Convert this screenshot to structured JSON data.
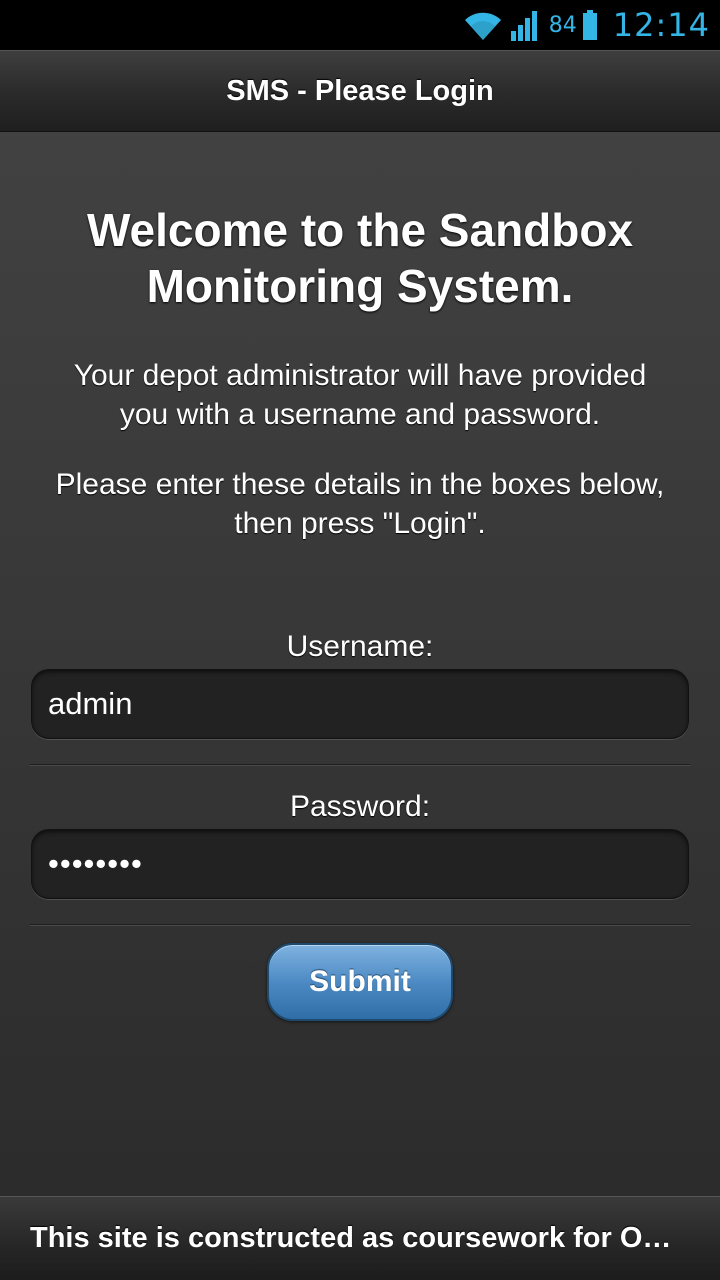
{
  "status_bar": {
    "battery_percent": "84",
    "time": "12:14",
    "icons": [
      "wifi-icon",
      "signal-icon",
      "battery-icon"
    ],
    "accent_color": "#33b5e5"
  },
  "header": {
    "title": "SMS - Please Login"
  },
  "main": {
    "welcome_line1": "Welcome to the Sandbox",
    "welcome_line2": "Monitoring System.",
    "intro_line1": "Your depot administrator will have provided",
    "intro_line2": "you with a username and password.",
    "instruction_line1": "Please enter these details in the boxes below,",
    "instruction_line2": "then press \"Login\"."
  },
  "form": {
    "username_label": "Username:",
    "username_value": "admin",
    "password_label": "Password:",
    "password_value": "••••••••",
    "submit_label": "Submit"
  },
  "footer": {
    "text": "This site is constructed as coursework for O…"
  },
  "colors": {
    "button": "#4d8ac4",
    "background": "#333333"
  }
}
